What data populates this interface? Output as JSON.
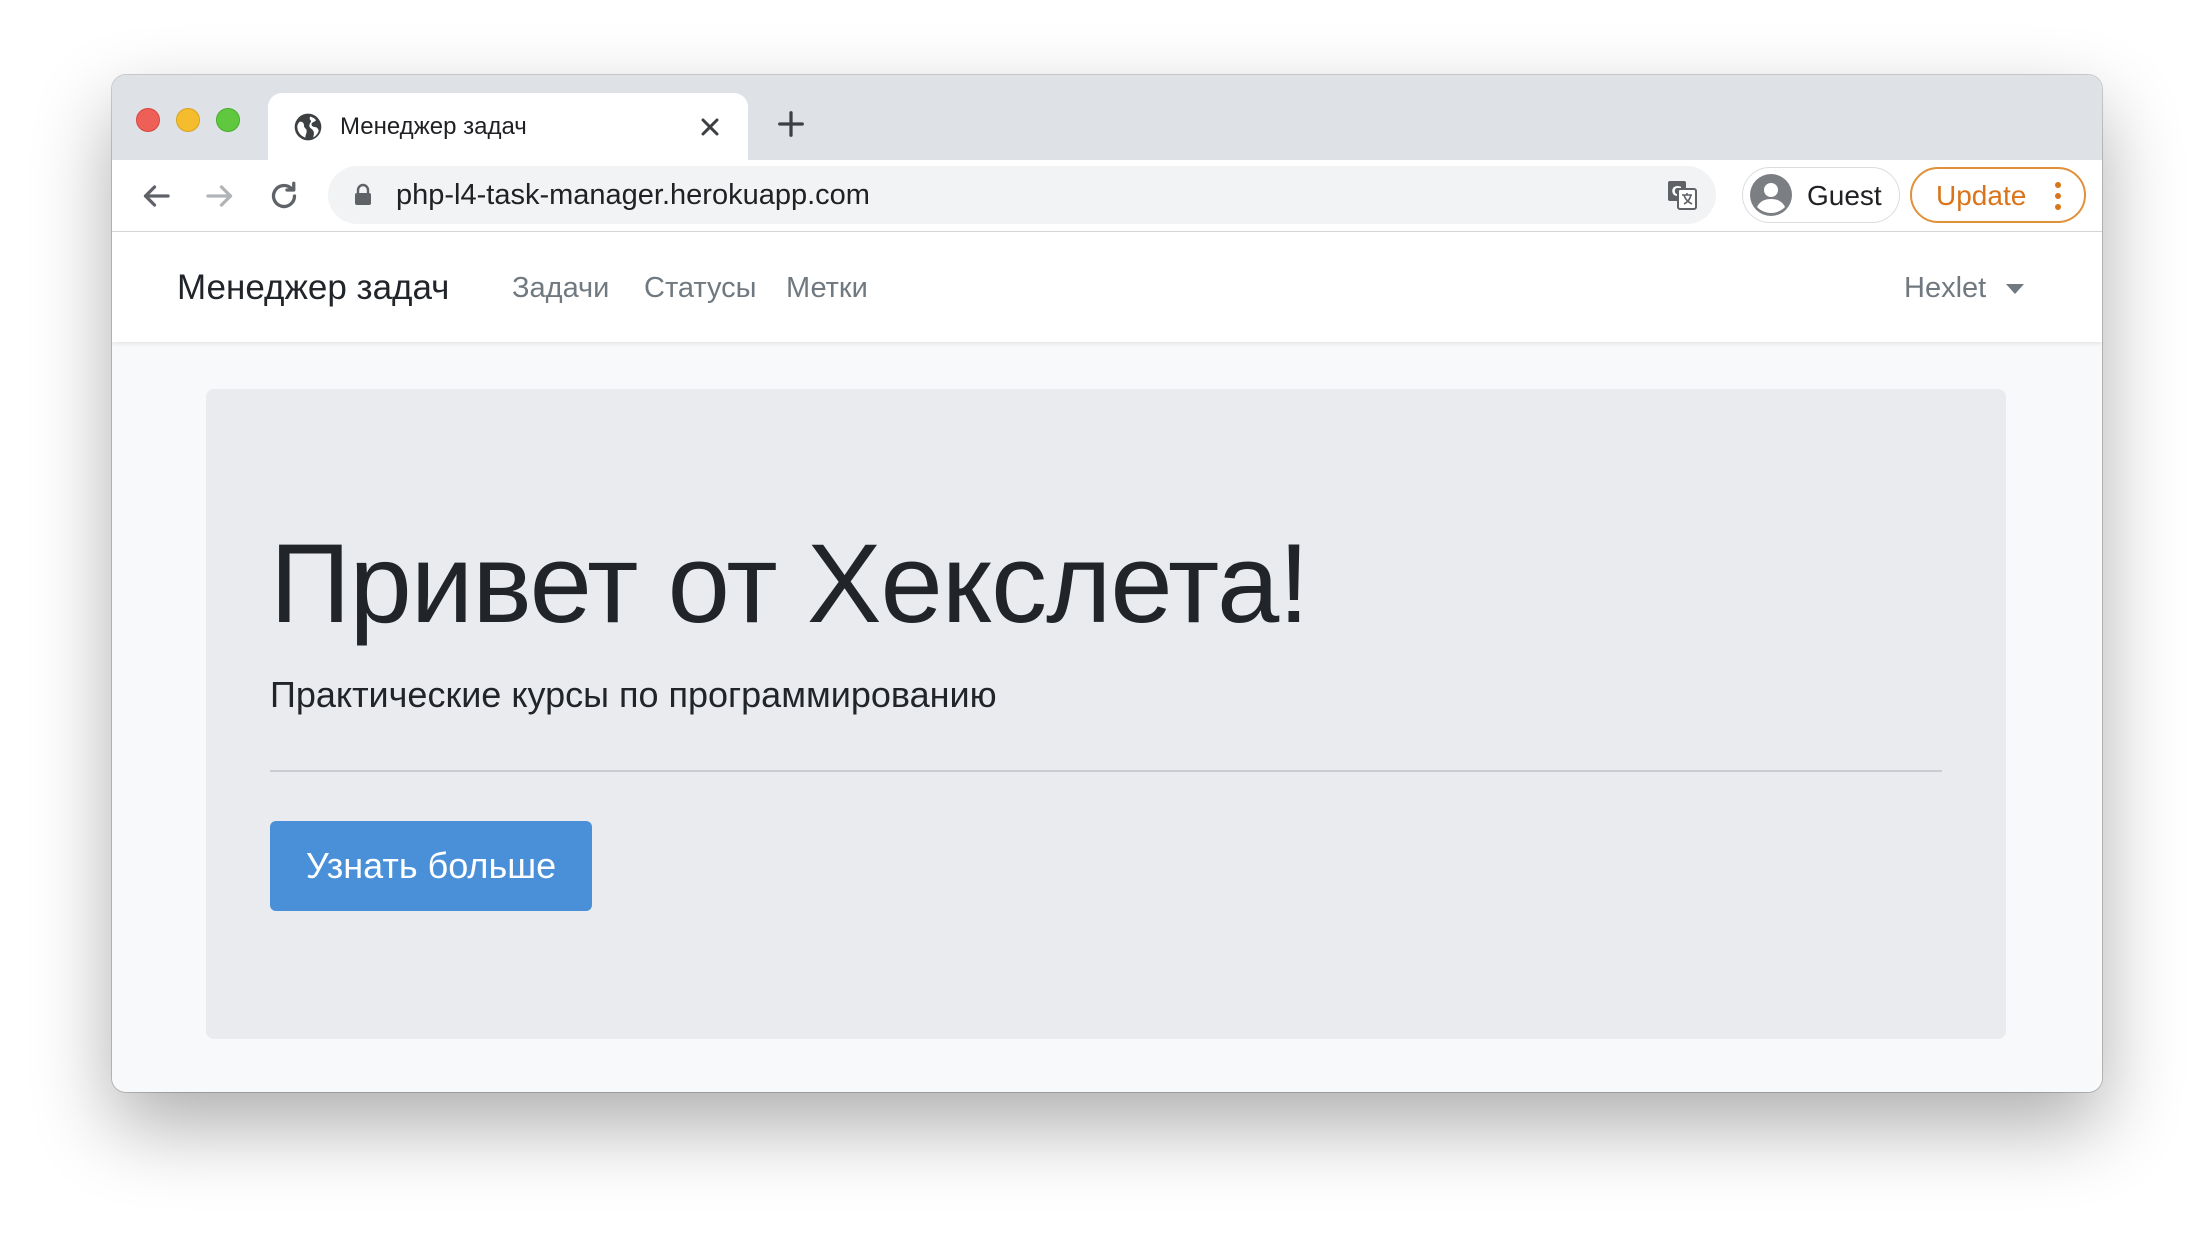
{
  "browser": {
    "tab_title": "Менеджер задач",
    "url": "php-l4-task-manager.herokuapp.com",
    "profile_label": "Guest",
    "update_label": "Update",
    "icons": [
      "globe-icon",
      "close-icon",
      "plus-icon",
      "back-arrow-icon",
      "forward-arrow-icon",
      "reload-icon",
      "lock-icon",
      "translate-icon",
      "avatar-icon",
      "more-vert-icon"
    ],
    "accent_update": "#d9741a"
  },
  "navbar": {
    "brand": "Менеджер задач",
    "links": [
      {
        "label": "Задачи"
      },
      {
        "label": "Статусы"
      },
      {
        "label": "Метки"
      }
    ],
    "user_menu": "Hexlet"
  },
  "hero": {
    "title": "Привет от Хекслета!",
    "lead": "Практические курсы по программированию",
    "button_label": "Узнать больше",
    "button_color": "#4a90d9"
  }
}
